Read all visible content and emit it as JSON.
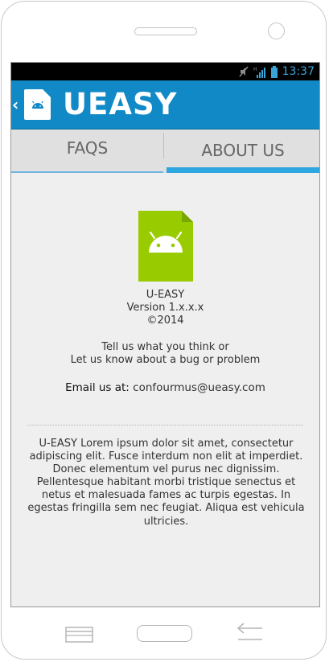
{
  "status_bar": {
    "time": "13:37",
    "icons": [
      "mute-icon",
      "signal-icon",
      "battery-icon"
    ]
  },
  "app_bar": {
    "title": "UEASY",
    "back_icon": "chevron-left-icon",
    "logo_icon": "android-app-icon"
  },
  "tabs": [
    {
      "label": "FAQS",
      "selected": false
    },
    {
      "label": "ABOUT US",
      "selected": true
    }
  ],
  "about": {
    "app_name": "U-EASY",
    "version": "Version 1.x.x.x",
    "copyright": "©2014",
    "feedback_line1": "Tell us what you think or",
    "feedback_line2": "Let us know about a bug or problem",
    "email_label": "Email us at:",
    "email_value": "confourmus@ueasy.com",
    "description": "U-EASY Lorem ipsum dolor sit amet, consectetur adipiscing elit. Fusce interdum non elit at imperdiet. Donec elementum vel purus nec dignissim. Pellentesque habitant morbi tristique senectus et netus et malesuada fames ac turpis egestas. In egestas fringilla sem nec feugiat. Aliqua est vehicula ultricies."
  },
  "nav_bar": {
    "buttons": [
      "menu-icon",
      "home-button",
      "back-arrow-icon"
    ]
  },
  "colors": {
    "app_bar": "#1089c6",
    "tab_indicator": "#2ea6df",
    "app_icon": "#99cc00",
    "status_time": "#3aa4d8"
  }
}
